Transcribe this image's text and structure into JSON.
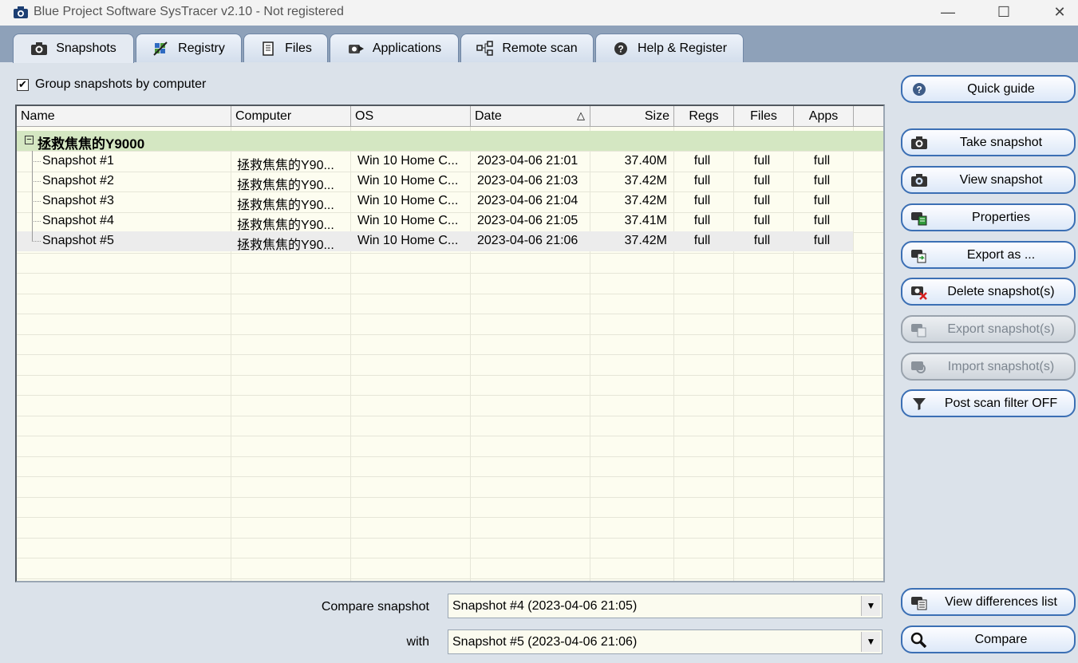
{
  "window": {
    "title": "Blue Project Software SysTracer v2.10 - Not registered",
    "minimize": "—",
    "maximize": "☐",
    "close": "✕"
  },
  "tabs": [
    {
      "label": "Snapshots",
      "icon": "camera-icon",
      "active": true
    },
    {
      "label": "Registry",
      "icon": "registry-icon",
      "active": false
    },
    {
      "label": "Files",
      "icon": "file-icon",
      "active": false
    },
    {
      "label": "Applications",
      "icon": "applications-icon",
      "active": false
    },
    {
      "label": "Remote scan",
      "icon": "network-icon",
      "active": false
    },
    {
      "label": "Help & Register",
      "icon": "help-icon",
      "active": false
    }
  ],
  "group_checkbox": {
    "label": "Group snapshots by computer",
    "checked": true,
    "mark": "✔"
  },
  "table": {
    "columns": [
      "Name",
      "Computer",
      "OS",
      "Date",
      "Size",
      "Regs",
      "Files",
      "Apps"
    ],
    "sort_indicator": "△",
    "group": {
      "expander": "−",
      "name": "拯救焦焦的Y9000"
    },
    "rows": [
      {
        "name": "Snapshot #1",
        "computer": "拯救焦焦的Y90...",
        "os": "Win 10 Home C...",
        "date": "2023-04-06 21:01",
        "size": "37.40M",
        "regs": "full",
        "files": "full",
        "apps": "full"
      },
      {
        "name": "Snapshot #2",
        "computer": "拯救焦焦的Y90...",
        "os": "Win 10 Home C...",
        "date": "2023-04-06 21:03",
        "size": "37.42M",
        "regs": "full",
        "files": "full",
        "apps": "full"
      },
      {
        "name": "Snapshot #3",
        "computer": "拯救焦焦的Y90...",
        "os": "Win 10 Home C...",
        "date": "2023-04-06 21:04",
        "size": "37.42M",
        "regs": "full",
        "files": "full",
        "apps": "full"
      },
      {
        "name": "Snapshot #4",
        "computer": "拯救焦焦的Y90...",
        "os": "Win 10 Home C...",
        "date": "2023-04-06 21:05",
        "size": "37.41M",
        "regs": "full",
        "files": "full",
        "apps": "full"
      },
      {
        "name": "Snapshot #5",
        "computer": "拯救焦焦的Y90...",
        "os": "Win 10 Home C...",
        "date": "2023-04-06 21:06",
        "size": "37.42M",
        "regs": "full",
        "files": "full",
        "apps": "full"
      }
    ]
  },
  "side_buttons": [
    {
      "label": "Quick guide",
      "icon": "help-icon",
      "enabled": true
    },
    {
      "label": "Take snapshot",
      "icon": "camera-icon",
      "enabled": true
    },
    {
      "label": "View snapshot",
      "icon": "view-snapshot-icon",
      "enabled": true
    },
    {
      "label": "Properties",
      "icon": "properties-icon",
      "enabled": true
    },
    {
      "label": "Export as ...",
      "icon": "export-icon",
      "enabled": true
    },
    {
      "label": "Delete snapshot(s)",
      "icon": "delete-icon",
      "enabled": true
    },
    {
      "label": "Export snapshot(s)",
      "icon": "export-snapshot-icon",
      "enabled": false
    },
    {
      "label": "Import snapshot(s)",
      "icon": "import-snapshot-icon",
      "enabled": false
    },
    {
      "label": "Post scan filter OFF",
      "icon": "filter-icon",
      "enabled": true
    },
    {
      "label": "View differences list",
      "icon": "differences-icon",
      "enabled": true
    },
    {
      "label": "Compare",
      "icon": "magnifier-icon",
      "enabled": true
    }
  ],
  "compare": {
    "label": "Compare snapshot",
    "value": "Snapshot #4 (2023-04-06 21:05)",
    "with_label": "with",
    "with_value": "Snapshot #5 (2023-04-06 21:06)",
    "arrow": "▼"
  },
  "colors": {
    "accent": "#3b6fb4",
    "group_row": "#d4e7c2",
    "grid_bg": "#fdfdf0",
    "tabstrip": "#8ea1b9"
  }
}
